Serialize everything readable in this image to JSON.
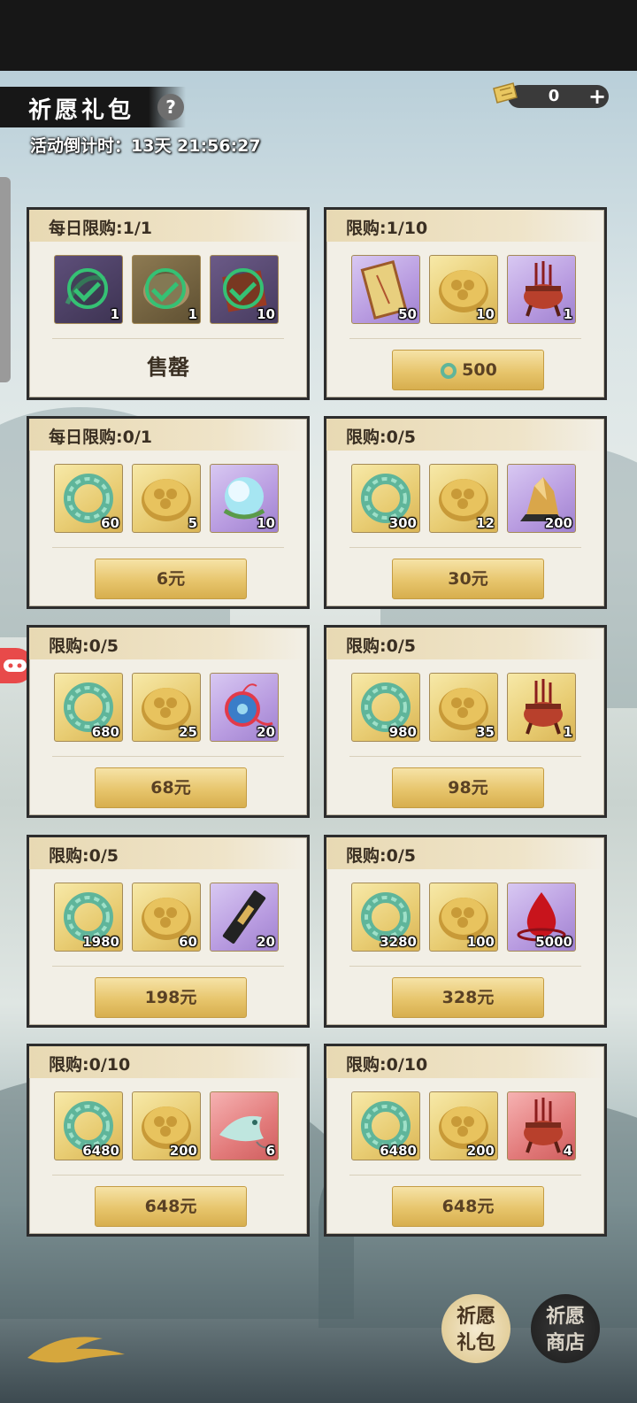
{
  "header": {
    "title": "祈愿礼包",
    "help_icon": "?",
    "countdown": "活动倒计时：13天 21:56:27",
    "currency_value": "0",
    "currency_plus": "+"
  },
  "cards": [
    {
      "label": "每日限购:1/1",
      "items": [
        {
          "qty": "1",
          "icon": "green-hair-item-icon",
          "bg": "soldbg"
        },
        {
          "qty": "1",
          "icon": "shell-item-icon",
          "bg": "soldbg2"
        },
        {
          "qty": "10",
          "icon": "red-book-icon",
          "bg": "soldbg3"
        }
      ],
      "sold_out": true,
      "sold_text": "售罄"
    },
    {
      "label": "限购:1/10",
      "items": [
        {
          "qty": "50",
          "icon": "talisman-scroll-icon",
          "bg": "purple"
        },
        {
          "qty": "10",
          "icon": "gold-coin-icon",
          "bg": "gold"
        },
        {
          "qty": "1",
          "icon": "incense-burner-icon",
          "bg": "purple"
        }
      ],
      "price": "500",
      "price_icon": "jade-icon"
    },
    {
      "label": "每日限购:0/1",
      "items": [
        {
          "qty": "60",
          "icon": "jade-ring-icon",
          "bg": "gold"
        },
        {
          "qty": "5",
          "icon": "gold-coin-icon",
          "bg": "gold"
        },
        {
          "qty": "10",
          "icon": "lotus-orb-icon",
          "bg": "purple"
        }
      ],
      "price": "6元"
    },
    {
      "label": "限购:0/5",
      "items": [
        {
          "qty": "300",
          "icon": "jade-ring-icon",
          "bg": "gold"
        },
        {
          "qty": "12",
          "icon": "gold-coin-icon",
          "bg": "gold"
        },
        {
          "qty": "200",
          "icon": "gold-ore-icon",
          "bg": "purple"
        }
      ],
      "price": "30元"
    },
    {
      "label": "限购:0/5",
      "items": [
        {
          "qty": "680",
          "icon": "jade-ring-icon",
          "bg": "gold"
        },
        {
          "qty": "25",
          "icon": "gold-coin-icon",
          "bg": "gold"
        },
        {
          "qty": "20",
          "icon": "pendant-charm-icon",
          "bg": "purple"
        }
      ],
      "price": "68元"
    },
    {
      "label": "限购:0/5",
      "items": [
        {
          "qty": "980",
          "icon": "jade-ring-icon",
          "bg": "gold"
        },
        {
          "qty": "35",
          "icon": "gold-coin-icon",
          "bg": "gold"
        },
        {
          "qty": "1",
          "icon": "incense-burner-icon",
          "bg": "gold"
        }
      ],
      "price": "98元"
    },
    {
      "label": "限购:0/5",
      "items": [
        {
          "qty": "1980",
          "icon": "jade-ring-icon",
          "bg": "gold"
        },
        {
          "qty": "60",
          "icon": "gold-coin-icon",
          "bg": "gold"
        },
        {
          "qty": "20",
          "icon": "ink-stick-icon",
          "bg": "purple"
        }
      ],
      "price": "198元"
    },
    {
      "label": "限购:0/5",
      "items": [
        {
          "qty": "3280",
          "icon": "jade-ring-icon",
          "bg": "gold"
        },
        {
          "qty": "100",
          "icon": "gold-coin-icon",
          "bg": "gold"
        },
        {
          "qty": "5000",
          "icon": "blood-drop-icon",
          "bg": "purple"
        }
      ],
      "price": "328元"
    },
    {
      "label": "限购:0/10",
      "items": [
        {
          "qty": "6480",
          "icon": "jade-ring-icon",
          "bg": "gold"
        },
        {
          "qty": "200",
          "icon": "gold-coin-icon",
          "bg": "gold"
        },
        {
          "qty": "6",
          "icon": "jade-fish-icon",
          "bg": "red"
        }
      ],
      "price": "648元"
    },
    {
      "label": "限购:0/10",
      "items": [
        {
          "qty": "6480",
          "icon": "jade-ring-icon",
          "bg": "gold"
        },
        {
          "qty": "200",
          "icon": "gold-coin-icon",
          "bg": "gold"
        },
        {
          "qty": "4",
          "icon": "incense-burner-icon",
          "bg": "red"
        }
      ],
      "price": "648元"
    }
  ],
  "bottom_nav": {
    "wish_pack_top": "祈愿",
    "wish_pack_bottom": "礼包",
    "wish_shop_top": "祈愿",
    "wish_shop_bottom": "商店"
  }
}
